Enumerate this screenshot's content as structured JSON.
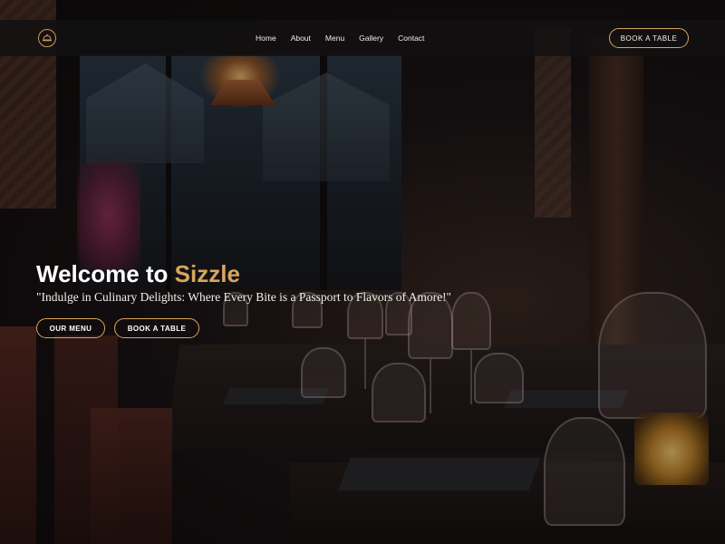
{
  "colors": {
    "accent": "#d9a55c",
    "navbar_bg": "#121010",
    "text": "#ffffff"
  },
  "navbar": {
    "logo_icon": "cloche-icon",
    "links": [
      "Home",
      "About",
      "Menu",
      "Gallery",
      "Contact"
    ],
    "cta": "BOOK A TABLE"
  },
  "hero": {
    "title_prefix": "Welcome to ",
    "title_brand": "Sizzle",
    "subtitle": "\"Indulge in Culinary Delights: Where Every Bite is a Passport to Flavors of Amore!\"",
    "buttons": {
      "menu": "OUR MENU",
      "book": "BOOK A TABLE"
    }
  }
}
